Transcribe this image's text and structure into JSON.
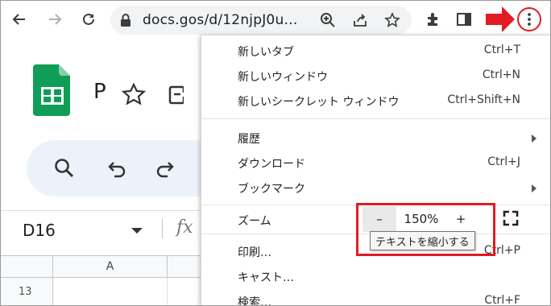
{
  "browser": {
    "url": "docs.goo​gle.com/spreadsheets/d/12njpJ0u…",
    "url_display": "docs.gos/d/12njpJ0u…",
    "icons": [
      "back-icon",
      "forward-icon",
      "reload-icon",
      "lock-icon",
      "zoom-icon",
      "share-icon",
      "bookmark-star-icon",
      "extensions-icon",
      "side-panel-icon",
      "more-menu-icon"
    ]
  },
  "sheets": {
    "title_initial": "P",
    "cell_ref": "D16",
    "fx_label": "fx",
    "column_a": "A",
    "row_13": "13"
  },
  "menu": {
    "new_tab": {
      "label": "新しいタブ",
      "shortcut": "Ctrl+T"
    },
    "new_window": {
      "label": "新しいウィンドウ",
      "shortcut": "Ctrl+N"
    },
    "new_incognito": {
      "label": "新しいシークレット ウィンドウ",
      "shortcut": "Ctrl+Shift+N"
    },
    "history": {
      "label": "履歴"
    },
    "downloads": {
      "label": "ダウンロード",
      "shortcut": "Ctrl+J"
    },
    "bookmarks": {
      "label": "ブックマーク"
    },
    "zoom": {
      "label": "ズーム",
      "minus": "–",
      "value": "150%",
      "plus": "+"
    },
    "print": {
      "label": "印刷…",
      "shortcut": "Ctrl+P"
    },
    "cast": {
      "label": "キャスト…"
    },
    "find": {
      "label": "検索…",
      "shortcut": "Ctrl+F"
    }
  },
  "tooltip": {
    "text": "テキストを縮小する"
  },
  "colors": {
    "annotation": "#e31b23",
    "sheets_green": "#0f9d58"
  }
}
